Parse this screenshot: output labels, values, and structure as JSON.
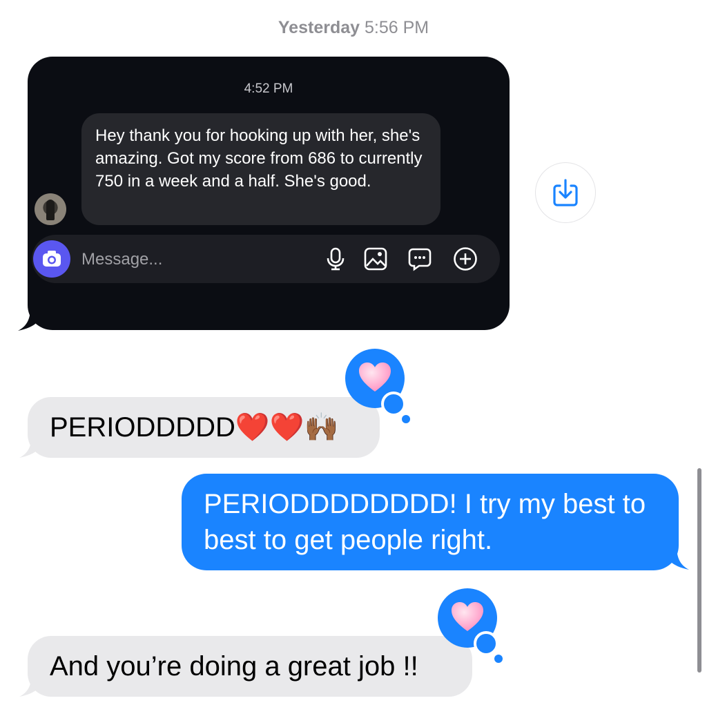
{
  "header": {
    "day": "Yesterday",
    "time": "5:56 PM"
  },
  "screenshot": {
    "time": "4:52 PM",
    "message": "Hey thank you for hooking up with her, she's amazing. Got my score from 686 to currently 750 in a week and a half. She's good.",
    "composer_placeholder": "Message...",
    "composer_icons": [
      "camera-icon",
      "microphone-icon",
      "image-icon",
      "sticker-icon",
      "plus-icon"
    ]
  },
  "messages": [
    {
      "side": "in",
      "text": "PERIODDDDD❤️❤️🙌🏾",
      "tapback": "heart"
    },
    {
      "side": "out",
      "text": "PERIODDDDDDDD! I try my best to best to get people right."
    },
    {
      "side": "in",
      "text": "And you’re doing a great job !!",
      "tapback": "heart"
    }
  ],
  "colors": {
    "outgoing_bubble": "#1a84ff",
    "incoming_bubble": "#e9e9eb",
    "dark_background": "#0b0d13",
    "camera_button": "#5a57f0"
  }
}
